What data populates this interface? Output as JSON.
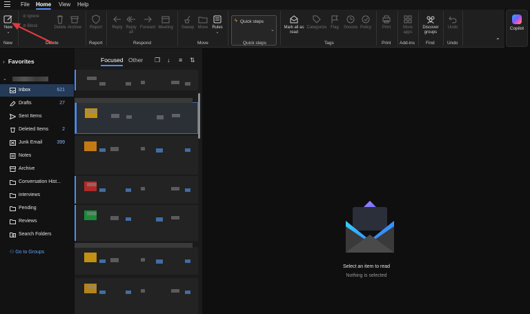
{
  "menubar": {
    "items": [
      "File",
      "Home",
      "View",
      "Help"
    ],
    "active": "Home"
  },
  "ribbon": {
    "groups": {
      "new": {
        "label": "New",
        "new_label": "New"
      },
      "delete": {
        "label": "Delete",
        "ignore": "Ignore",
        "block": "Block",
        "delete": "Delete",
        "archive": "Archive"
      },
      "report": {
        "label": "Report",
        "report": "Report"
      },
      "respond": {
        "label": "Respond",
        "reply": "Reply",
        "reply_all_1": "Reply",
        "reply_all_2": "all",
        "forward": "Forward",
        "meeting": "Meeting"
      },
      "move": {
        "label": "Move",
        "sweep": "Sweep",
        "move": "Move",
        "rules": "Rules"
      },
      "quick_steps": {
        "label": "Quick steps",
        "button": "Quick steps"
      },
      "tags": {
        "label": "Tags",
        "mark_all_1": "Mark all as",
        "mark_all_2": "read",
        "categorize": "Categorize",
        "flag": "Flag",
        "snooze": "Snooze",
        "policy": "Policy"
      },
      "print": {
        "label": "Print",
        "print": "Print"
      },
      "addins": {
        "label": "Add-ins",
        "more_1": "More",
        "more_2": "apps"
      },
      "find": {
        "label": "Find",
        "discover_1": "Discover",
        "discover_2": "groups"
      },
      "undo": {
        "label": "Undo",
        "undo": "Undo"
      }
    },
    "copilot": "Copilot"
  },
  "sidebar": {
    "favorites": "Favorites",
    "folders": [
      {
        "label": "Inbox",
        "count": "621",
        "icon": "inbox-icon",
        "selected": true
      },
      {
        "label": "Drafts",
        "count": "27",
        "icon": "pencil-icon"
      },
      {
        "label": "Sent Items",
        "count": "",
        "icon": "send-icon"
      },
      {
        "label": "Deleted Items",
        "count": "2",
        "icon": "trash-icon"
      },
      {
        "label": "Junk Email",
        "count": "399",
        "icon": "junk-icon"
      },
      {
        "label": "Notes",
        "count": "",
        "icon": "note-icon"
      },
      {
        "label": "Archive",
        "count": "",
        "icon": "archive-icon"
      },
      {
        "label": "Conversation Hist...",
        "count": "",
        "icon": "folder-icon"
      },
      {
        "label": "interviews",
        "count": "",
        "icon": "folder-icon"
      },
      {
        "label": "Pending",
        "count": "",
        "icon": "folder-icon"
      },
      {
        "label": "Reviews",
        "count": "",
        "icon": "folder-icon"
      },
      {
        "label": "Search Folders",
        "count": "",
        "icon": "search-folder-icon"
      }
    ],
    "groups_link": "Go to Groups"
  },
  "message_list": {
    "tab_focused": "Focused",
    "tab_other": "Other"
  },
  "reading_pane": {
    "title": "Select an item to read",
    "subtitle": "Nothing is selected"
  },
  "colors": {
    "accent": "#4f8ff7",
    "selected_folder": "#243a57",
    "annotation": "#e0393e"
  }
}
